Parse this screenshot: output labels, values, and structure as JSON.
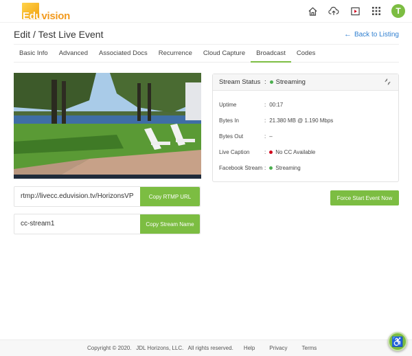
{
  "brand": {
    "logo_left": "Edu",
    "logo_right": "vision",
    "accent": "#7cbd42",
    "link": "#2f7fd0"
  },
  "topbar": {
    "icons": [
      "home-icon",
      "cloud-upload-icon",
      "video-play-icon",
      "apps-grid-icon"
    ],
    "avatar_initial": "T"
  },
  "page": {
    "title": "Edit / Test Live Event",
    "back_link": "Back to Listing"
  },
  "tabs": [
    {
      "label": "Basic Info",
      "active": false
    },
    {
      "label": "Advanced",
      "active": false
    },
    {
      "label": "Associated Docs",
      "active": false
    },
    {
      "label": "Recurrence",
      "active": false
    },
    {
      "label": "Cloud Capture",
      "active": false
    },
    {
      "label": "Broadcast",
      "active": true
    },
    {
      "label": "Codes",
      "active": false
    }
  ],
  "stream": {
    "rtmp_url": "rtmp://livecc.eduvision.tv/HorizonsVP",
    "copy_rtmp_label": "Copy RTMP URL",
    "stream_name": "cc-stream1",
    "copy_name_label": "Copy Stream Name"
  },
  "status": {
    "header_label": "Stream Status",
    "header_value": "Streaming",
    "header_state": "green",
    "rows": [
      {
        "label": "Uptime",
        "value": "00:17",
        "dot": null
      },
      {
        "label": "Bytes In",
        "value": "21.380 MB @ 1.190 Mbps",
        "dot": null
      },
      {
        "label": "Bytes Out",
        "value": "–",
        "dot": null
      },
      {
        "label": "Live Caption",
        "value": "No CC Available",
        "dot": "red"
      },
      {
        "label": "Facebook Stream",
        "value": "Streaming",
        "dot": "green"
      }
    ]
  },
  "actions": {
    "force_start": "Force Start Event Now"
  },
  "footer": {
    "copyright": "Copyright © 2020.   JDL Horizons, LLC.   All rights reserved.",
    "links": [
      "Help",
      "Privacy",
      "Terms"
    ]
  },
  "accessibility_icon": "♿"
}
